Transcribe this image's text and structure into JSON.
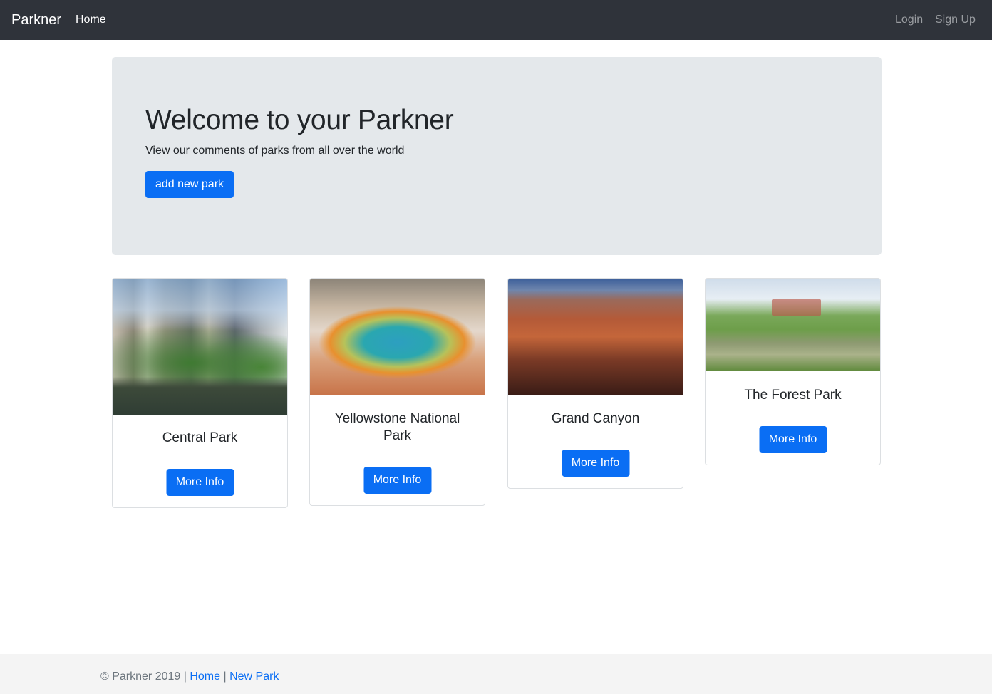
{
  "navbar": {
    "brand": "Parkner",
    "home": "Home",
    "login": "Login",
    "signup": "Sign Up"
  },
  "jumbotron": {
    "title": "Welcome to your Parkner",
    "lead": "View our comments of parks from all over the world",
    "button": "add new park"
  },
  "cards": [
    {
      "title": "Central Park",
      "button": "More Info"
    },
    {
      "title": "Yellowstone National Park",
      "button": "More Info"
    },
    {
      "title": "Grand Canyon",
      "button": "More Info"
    },
    {
      "title": "The Forest Park",
      "button": "More Info"
    }
  ],
  "footer": {
    "copyright": "© Parkner 2019",
    "sep1": " | ",
    "home_link": "Home",
    "sep2": " | ",
    "new_park_link": "New Park"
  },
  "colors": {
    "navbar_bg": "#2f333a",
    "primary": "#0a6ef4",
    "jumbotron_bg": "#e4e8eb",
    "footer_bg": "#f4f4f4"
  }
}
